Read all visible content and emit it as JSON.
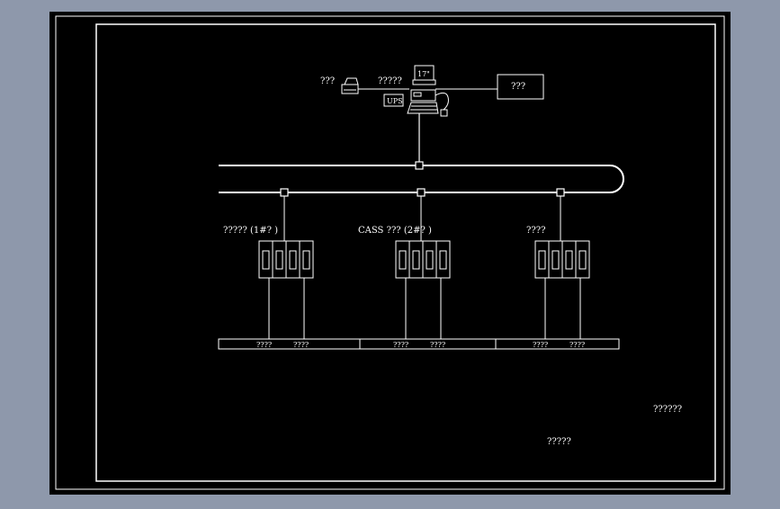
{
  "colors": {
    "background": "#8e98ab",
    "drawing": "#000000",
    "lines": "#ffffff"
  },
  "top": {
    "printer_label": "???",
    "workstation_label": "?????",
    "monitor_label": "17\"",
    "ups_label": "UPS",
    "right_box_label": "???"
  },
  "stations": [
    {
      "label": "????? (1#?  )",
      "bus_labels": [
        "????",
        "????"
      ]
    },
    {
      "label": "CASS ??? (2#?  )",
      "bus_labels": [
        "????",
        "????"
      ]
    },
    {
      "label": "????",
      "bus_labels": [
        "????",
        "????"
      ]
    }
  ],
  "notes": {
    "note_right": "??????",
    "note_bottom": "?????"
  },
  "icons": {
    "printer": "printer-icon",
    "computer": "computer-icon",
    "mouse": "mouse-icon",
    "network_node": "network-node-icon"
  }
}
